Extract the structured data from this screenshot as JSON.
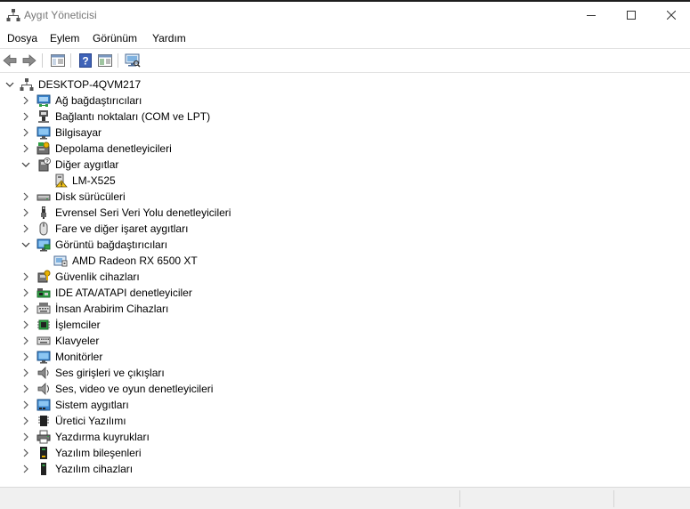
{
  "window": {
    "title": "Aygıt Yöneticisi"
  },
  "menu": [
    "Dosya",
    "Eylem",
    "Görünüm",
    "Yardım"
  ],
  "toolbar": [
    "back-icon",
    "forward-icon",
    "show-hide-tree-icon",
    "help-icon",
    "properties-icon",
    "scan-hardware-icon"
  ],
  "tree": {
    "root": {
      "label": "DESKTOP-4QVM217",
      "icon": "computer-root-icon"
    },
    "rows": [
      {
        "label": "Ağ bağdaştırıcıları",
        "icon": "network-adapter-icon",
        "level": 1,
        "expanded": false
      },
      {
        "label": "Bağlantı noktaları (COM ve LPT)",
        "icon": "port-icon",
        "level": 1,
        "expanded": false
      },
      {
        "label": "Bilgisayar",
        "icon": "computer-icon",
        "level": 1,
        "expanded": false
      },
      {
        "label": "Depolama denetleyicileri",
        "icon": "storage-controller-icon",
        "level": 1,
        "expanded": false
      },
      {
        "label": "Diğer aygıtlar",
        "icon": "unknown-device-icon",
        "level": 1,
        "expanded": true
      },
      {
        "label": "LM-X525",
        "icon": "warning-device-icon",
        "level": 2
      },
      {
        "label": "Disk sürücüleri",
        "icon": "disk-drive-icon",
        "level": 1,
        "expanded": false
      },
      {
        "label": "Evrensel Seri Veri Yolu denetleyicileri",
        "icon": "usb-icon",
        "level": 1,
        "expanded": false
      },
      {
        "label": "Fare ve diğer işaret aygıtları",
        "icon": "mouse-icon",
        "level": 1,
        "expanded": false
      },
      {
        "label": "Görüntü bağdaştırıcıları",
        "icon": "display-adapter-icon",
        "level": 1,
        "expanded": true
      },
      {
        "label": "AMD Radeon RX 6500 XT",
        "icon": "gpu-icon",
        "level": 2
      },
      {
        "label": "Güvenlik cihazları",
        "icon": "security-device-icon",
        "level": 1,
        "expanded": false
      },
      {
        "label": "IDE ATA/ATAPI denetleyiciler",
        "icon": "ide-controller-icon",
        "level": 1,
        "expanded": false
      },
      {
        "label": "İnsan Arabirim Cihazları",
        "icon": "hid-icon",
        "level": 1,
        "expanded": false
      },
      {
        "label": "İşlemciler",
        "icon": "processor-icon",
        "level": 1,
        "expanded": false
      },
      {
        "label": "Klavyeler",
        "icon": "keyboard-icon",
        "level": 1,
        "expanded": false
      },
      {
        "label": "Monitörler",
        "icon": "monitor-icon",
        "level": 1,
        "expanded": false
      },
      {
        "label": "Ses girişleri ve çıkışları",
        "icon": "speaker-icon",
        "level": 1,
        "expanded": false
      },
      {
        "label": "Ses, video ve oyun denetleyicileri",
        "icon": "sound-controller-icon",
        "level": 1,
        "expanded": false
      },
      {
        "label": "Sistem aygıtları",
        "icon": "system-device-icon",
        "level": 1,
        "expanded": false
      },
      {
        "label": "Üretici Yazılımı",
        "icon": "firmware-icon",
        "level": 1,
        "expanded": false
      },
      {
        "label": "Yazdırma kuyrukları",
        "icon": "printer-icon",
        "level": 1,
        "expanded": false
      },
      {
        "label": "Yazılım bileşenleri",
        "icon": "software-component-icon",
        "level": 1,
        "expanded": false
      },
      {
        "label": "Yazılım cihazları",
        "icon": "software-device-icon",
        "level": 1,
        "expanded": false
      }
    ]
  }
}
